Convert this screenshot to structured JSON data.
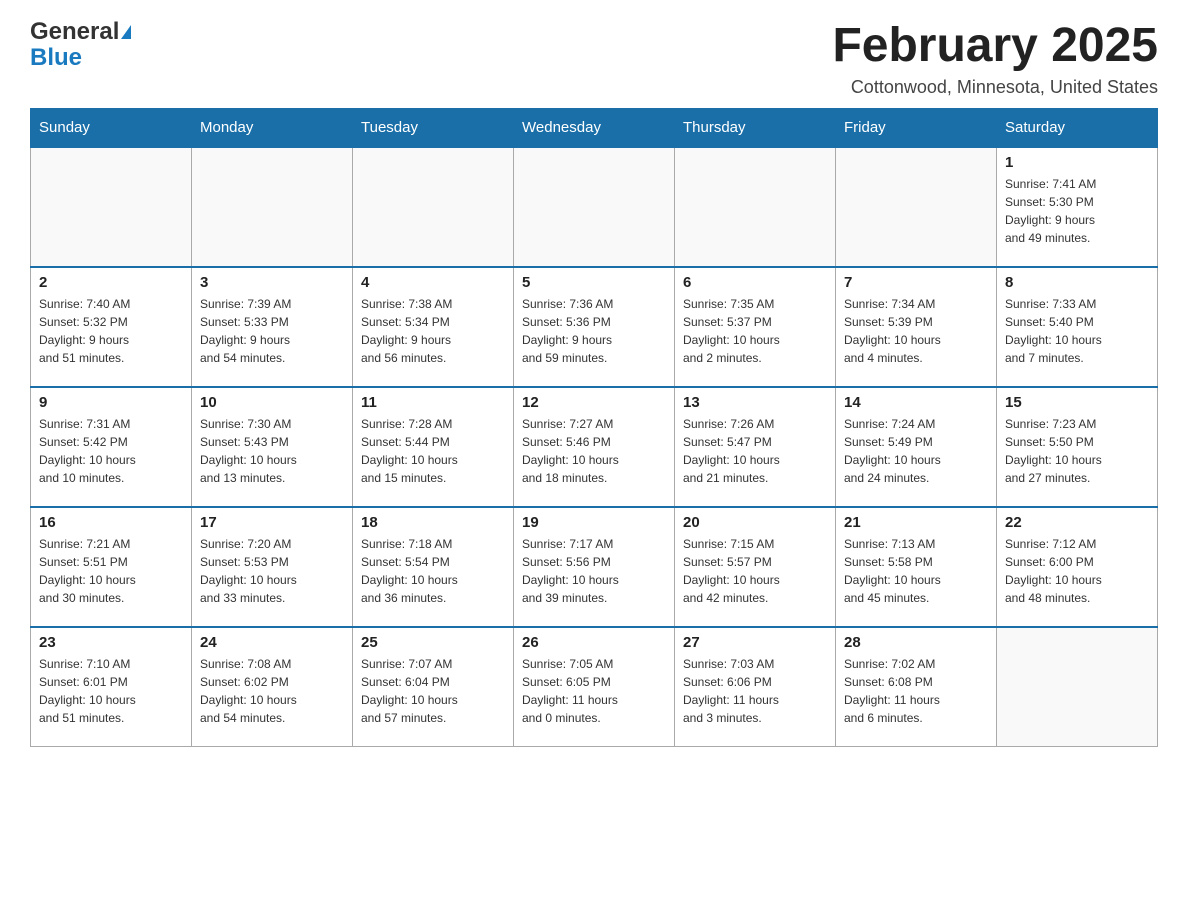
{
  "header": {
    "logo_general": "General",
    "logo_blue": "Blue",
    "month_title": "February 2025",
    "location": "Cottonwood, Minnesota, United States"
  },
  "days_of_week": [
    "Sunday",
    "Monday",
    "Tuesday",
    "Wednesday",
    "Thursday",
    "Friday",
    "Saturday"
  ],
  "weeks": [
    [
      {
        "day": "",
        "info": ""
      },
      {
        "day": "",
        "info": ""
      },
      {
        "day": "",
        "info": ""
      },
      {
        "day": "",
        "info": ""
      },
      {
        "day": "",
        "info": ""
      },
      {
        "day": "",
        "info": ""
      },
      {
        "day": "1",
        "info": "Sunrise: 7:41 AM\nSunset: 5:30 PM\nDaylight: 9 hours\nand 49 minutes."
      }
    ],
    [
      {
        "day": "2",
        "info": "Sunrise: 7:40 AM\nSunset: 5:32 PM\nDaylight: 9 hours\nand 51 minutes."
      },
      {
        "day": "3",
        "info": "Sunrise: 7:39 AM\nSunset: 5:33 PM\nDaylight: 9 hours\nand 54 minutes."
      },
      {
        "day": "4",
        "info": "Sunrise: 7:38 AM\nSunset: 5:34 PM\nDaylight: 9 hours\nand 56 minutes."
      },
      {
        "day": "5",
        "info": "Sunrise: 7:36 AM\nSunset: 5:36 PM\nDaylight: 9 hours\nand 59 minutes."
      },
      {
        "day": "6",
        "info": "Sunrise: 7:35 AM\nSunset: 5:37 PM\nDaylight: 10 hours\nand 2 minutes."
      },
      {
        "day": "7",
        "info": "Sunrise: 7:34 AM\nSunset: 5:39 PM\nDaylight: 10 hours\nand 4 minutes."
      },
      {
        "day": "8",
        "info": "Sunrise: 7:33 AM\nSunset: 5:40 PM\nDaylight: 10 hours\nand 7 minutes."
      }
    ],
    [
      {
        "day": "9",
        "info": "Sunrise: 7:31 AM\nSunset: 5:42 PM\nDaylight: 10 hours\nand 10 minutes."
      },
      {
        "day": "10",
        "info": "Sunrise: 7:30 AM\nSunset: 5:43 PM\nDaylight: 10 hours\nand 13 minutes."
      },
      {
        "day": "11",
        "info": "Sunrise: 7:28 AM\nSunset: 5:44 PM\nDaylight: 10 hours\nand 15 minutes."
      },
      {
        "day": "12",
        "info": "Sunrise: 7:27 AM\nSunset: 5:46 PM\nDaylight: 10 hours\nand 18 minutes."
      },
      {
        "day": "13",
        "info": "Sunrise: 7:26 AM\nSunset: 5:47 PM\nDaylight: 10 hours\nand 21 minutes."
      },
      {
        "day": "14",
        "info": "Sunrise: 7:24 AM\nSunset: 5:49 PM\nDaylight: 10 hours\nand 24 minutes."
      },
      {
        "day": "15",
        "info": "Sunrise: 7:23 AM\nSunset: 5:50 PM\nDaylight: 10 hours\nand 27 minutes."
      }
    ],
    [
      {
        "day": "16",
        "info": "Sunrise: 7:21 AM\nSunset: 5:51 PM\nDaylight: 10 hours\nand 30 minutes."
      },
      {
        "day": "17",
        "info": "Sunrise: 7:20 AM\nSunset: 5:53 PM\nDaylight: 10 hours\nand 33 minutes."
      },
      {
        "day": "18",
        "info": "Sunrise: 7:18 AM\nSunset: 5:54 PM\nDaylight: 10 hours\nand 36 minutes."
      },
      {
        "day": "19",
        "info": "Sunrise: 7:17 AM\nSunset: 5:56 PM\nDaylight: 10 hours\nand 39 minutes."
      },
      {
        "day": "20",
        "info": "Sunrise: 7:15 AM\nSunset: 5:57 PM\nDaylight: 10 hours\nand 42 minutes."
      },
      {
        "day": "21",
        "info": "Sunrise: 7:13 AM\nSunset: 5:58 PM\nDaylight: 10 hours\nand 45 minutes."
      },
      {
        "day": "22",
        "info": "Sunrise: 7:12 AM\nSunset: 6:00 PM\nDaylight: 10 hours\nand 48 minutes."
      }
    ],
    [
      {
        "day": "23",
        "info": "Sunrise: 7:10 AM\nSunset: 6:01 PM\nDaylight: 10 hours\nand 51 minutes."
      },
      {
        "day": "24",
        "info": "Sunrise: 7:08 AM\nSunset: 6:02 PM\nDaylight: 10 hours\nand 54 minutes."
      },
      {
        "day": "25",
        "info": "Sunrise: 7:07 AM\nSunset: 6:04 PM\nDaylight: 10 hours\nand 57 minutes."
      },
      {
        "day": "26",
        "info": "Sunrise: 7:05 AM\nSunset: 6:05 PM\nDaylight: 11 hours\nand 0 minutes."
      },
      {
        "day": "27",
        "info": "Sunrise: 7:03 AM\nSunset: 6:06 PM\nDaylight: 11 hours\nand 3 minutes."
      },
      {
        "day": "28",
        "info": "Sunrise: 7:02 AM\nSunset: 6:08 PM\nDaylight: 11 hours\nand 6 minutes."
      },
      {
        "day": "",
        "info": ""
      }
    ]
  ]
}
